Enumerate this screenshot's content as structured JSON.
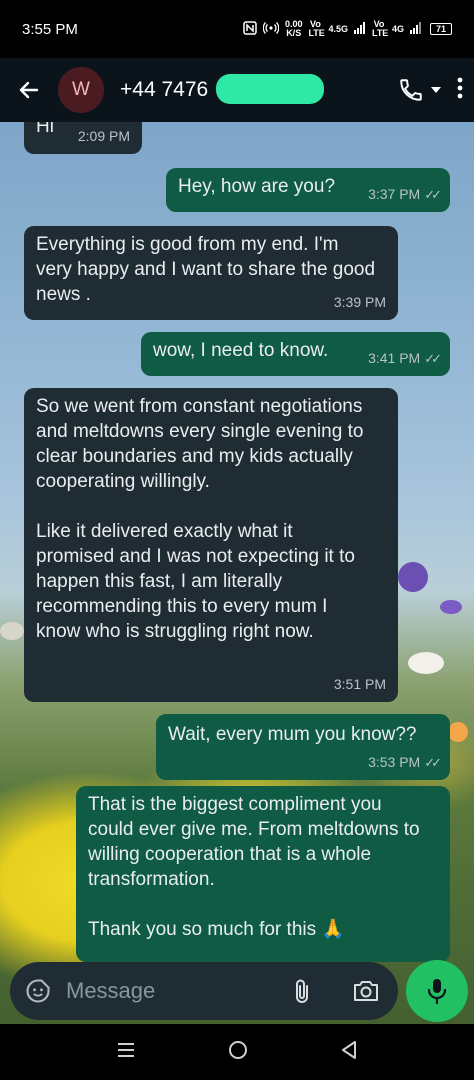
{
  "status_bar": {
    "time": "3:55 PM",
    "net_speed_value": "0.00",
    "net_speed_unit": "K/S",
    "sim1_label": "Vo LTE",
    "sim1_network": "4.5G",
    "sim2_label": "Vo LTE",
    "sim2_network": "4G",
    "battery": "71"
  },
  "header": {
    "avatar_letter": "W",
    "contact_name": "+44 7476"
  },
  "messages": [
    {
      "direction": "in",
      "text": "Hi",
      "time": "2:09 PM"
    },
    {
      "direction": "out",
      "text": "Hey, how are you?",
      "time": "3:37 PM",
      "ticks": "✓✓"
    },
    {
      "direction": "in",
      "text": "Everything is good from my end. I'm very happy and I want to share the good news .",
      "time": "3:39 PM"
    },
    {
      "direction": "out",
      "text": "wow, I need to know.",
      "time": "3:41 PM",
      "ticks": "✓✓"
    },
    {
      "direction": "in",
      "text": "So we went from constant negotiations and meltdowns every single evening to clear boundaries and my kids actually cooperating willingly.\n\nLike it delivered exactly what it promised and I was not expecting it to happen this fast, I am literally recommending this to every mum I know who is struggling right now.",
      "time": "3:51 PM"
    },
    {
      "direction": "out",
      "text": "Wait, every mum you know??",
      "time": "3:53 PM",
      "ticks": "✓✓"
    },
    {
      "direction": "out",
      "text": "That is the biggest compliment you could ever give me. From meltdowns to willing cooperation that is a whole transformation.\n\nThank you so much for this 🙏"
    }
  ],
  "composer": {
    "placeholder": "Message"
  },
  "colors": {
    "incoming_bubble": "#202c33",
    "outgoing_bubble": "#0f5b43",
    "accent_green": "#21c063",
    "header_bg": "#0b141a"
  }
}
